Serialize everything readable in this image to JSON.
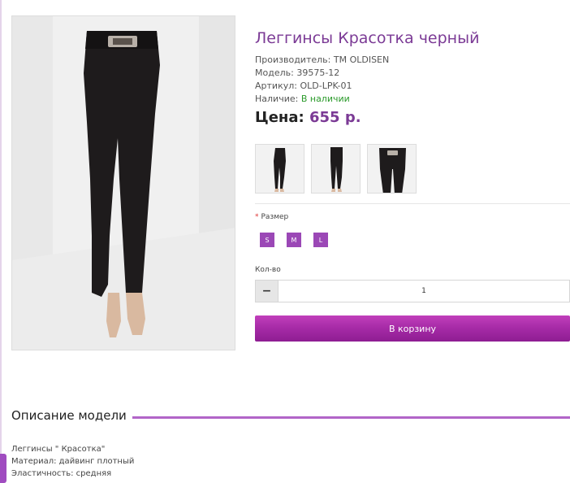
{
  "product": {
    "title": "Леггинсы Красотка черный",
    "manufacturer_label": "Производитель:",
    "manufacturer": "TM OLDISEN",
    "model_label": "Модель:",
    "model": "39575-12",
    "sku_label": "Артикул:",
    "sku": "OLD-LPK-01",
    "availability_label": "Наличие:",
    "availability": "В наличии",
    "price_label": "Цена:",
    "price": "655 р."
  },
  "options": {
    "size_label": "Размер",
    "required_mark": "*",
    "sizes": [
      "S",
      "M",
      "L"
    ]
  },
  "quantity": {
    "label": "Кол-во",
    "minus": "−",
    "value": "1"
  },
  "cart_button": "В корзину",
  "description": {
    "title": "Описание модели",
    "lines": [
      "Леггинсы \" Красотка\"",
      "Материал: дайвинг плотный",
      "Эластичность: средняя"
    ]
  },
  "colors": {
    "accent": "#7b3a95",
    "button": "#a52aa6",
    "in_stock": "#2a9a2a"
  }
}
